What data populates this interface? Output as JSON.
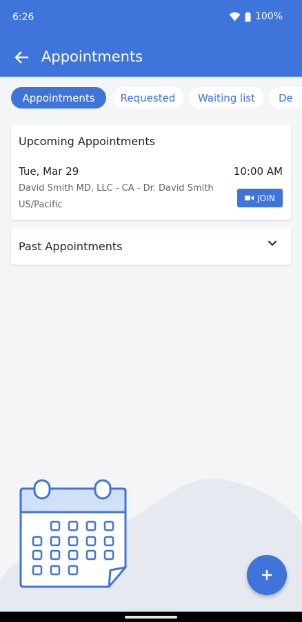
{
  "status_bar": {
    "time": "6:26",
    "battery": "100%"
  },
  "header": {
    "title": "Appointments"
  },
  "tabs": [
    {
      "label": "Appointments",
      "active": true
    },
    {
      "label": "Requested",
      "active": false
    },
    {
      "label": "Waiting list",
      "active": false
    },
    {
      "label": "De",
      "active": false
    }
  ],
  "upcoming": {
    "title": "Upcoming Appointments",
    "appointment": {
      "date": "Tue, Mar 29",
      "time": "10:00 AM",
      "provider": "David Smith MD, LLC - CA - Dr. David Smith",
      "timezone": "US/Pacific",
      "join_label": "JOIN"
    }
  },
  "past": {
    "title": "Past Appointments"
  },
  "icons": {
    "back": "arrow-left-icon",
    "video": "video-camera-icon",
    "expand": "chevron-down-icon",
    "add": "plus-icon",
    "illustration": "calendar-icon"
  },
  "colors": {
    "primary": "#3f74db",
    "background": "#f4f5f7",
    "card": "#ffffff"
  }
}
